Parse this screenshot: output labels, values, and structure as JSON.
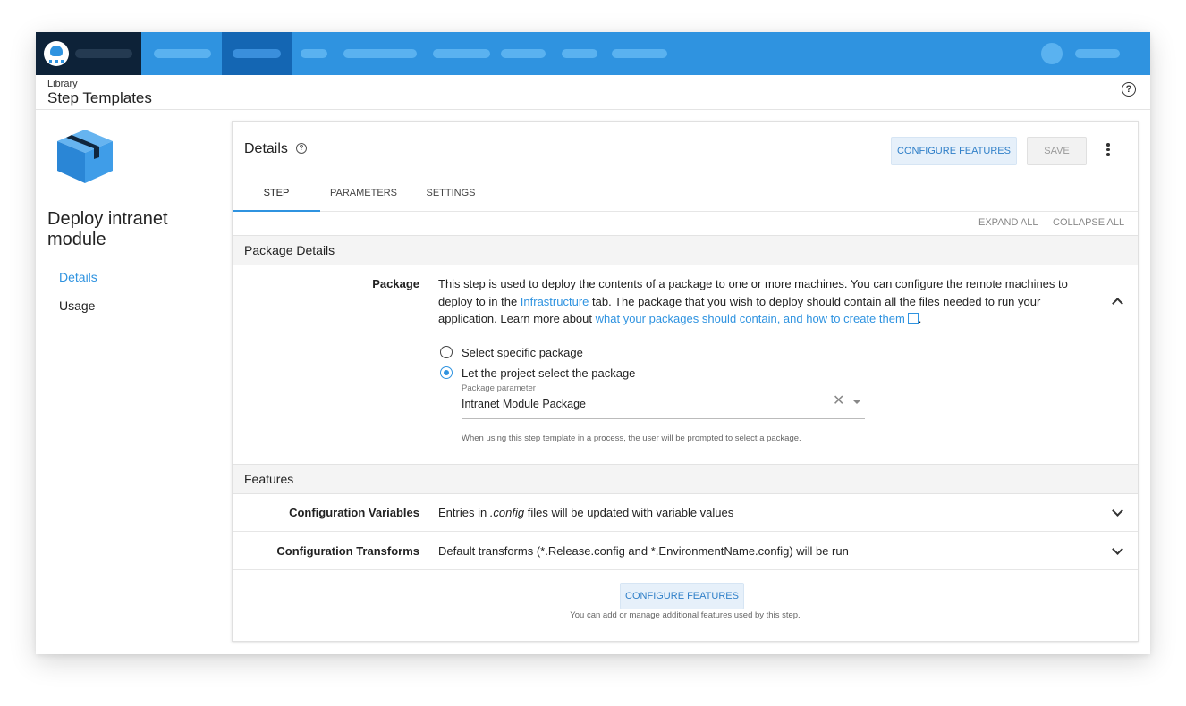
{
  "header": {
    "breadcrumb": "Library",
    "title": "Step Templates"
  },
  "sidebar": {
    "template_name": "Deploy intranet module",
    "items": [
      {
        "label": "Details",
        "active": true
      },
      {
        "label": "Usage",
        "active": false
      }
    ]
  },
  "card": {
    "title": "Details",
    "configure_features_label": "CONFIGURE FEATURES",
    "save_label": "SAVE",
    "tabs": [
      {
        "label": "STEP",
        "active": true
      },
      {
        "label": "PARAMETERS",
        "active": false
      },
      {
        "label": "SETTINGS",
        "active": false
      }
    ],
    "expand_all_label": "EXPAND ALL",
    "collapse_all_label": "COLLAPSE ALL"
  },
  "package_details": {
    "section_title": "Package Details",
    "row_label": "Package",
    "desc_part1": "This step is used to deploy the contents of a package to one or more machines. You can configure the remote machines to deploy to in the ",
    "infrastructure_link": "Infrastructure",
    "desc_part2": " tab. The package that you wish to deploy should contain all the files needed to run your application. Learn more about ",
    "learn_more_link": "what your packages should contain, and how to create them",
    "desc_end": ".",
    "radio_options": [
      {
        "label": "Select specific package",
        "checked": false
      },
      {
        "label": "Let the project select the package",
        "checked": true
      }
    ],
    "field_label": "Package parameter",
    "field_value": "Intranet Module Package",
    "helper_text": "When using this step template in a process, the user will be prompted to select a package."
  },
  "features": {
    "section_title": "Features",
    "rows": [
      {
        "label": "Configuration Variables",
        "text_prefix": "Entries in ",
        "text_em": ".config",
        "text_suffix": " files will be updated with variable values"
      },
      {
        "label": "Configuration Transforms",
        "text": "Default transforms (*.Release.config and *.EnvironmentName.config) will be run"
      }
    ],
    "configure_features_label": "CONFIGURE FEATURES",
    "note": "You can add or manage additional features used by this step."
  },
  "colors": {
    "accent": "#2f93e0",
    "topnav": "#2f93e0",
    "brand_bg": "#0d2238"
  },
  "icons": [
    "octopus-logo-icon",
    "help-icon",
    "package-box-icon",
    "more-vert-icon",
    "external-link-icon",
    "chevron-up-icon",
    "chevron-down-icon",
    "clear-icon",
    "dropdown-caret-icon"
  ]
}
